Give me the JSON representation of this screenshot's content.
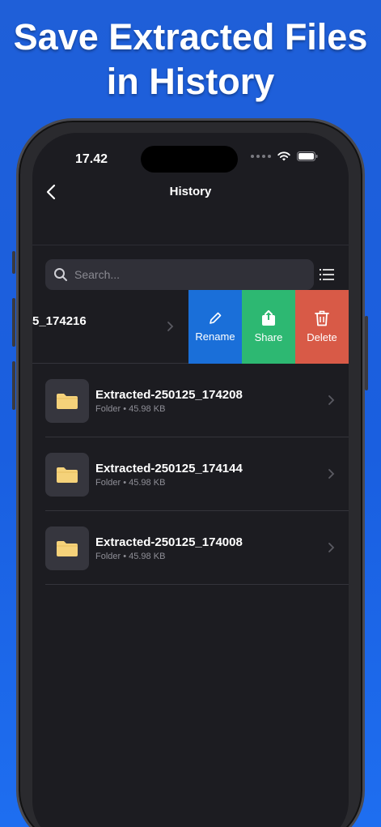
{
  "headline": {
    "line1": "Save Extracted Files",
    "line2": "in History"
  },
  "status_bar": {
    "time": "17.42"
  },
  "nav": {
    "title": "History"
  },
  "search": {
    "placeholder": "Search..."
  },
  "swiped_row": {
    "name": "5_174216",
    "actions": [
      {
        "label": "Rename",
        "color": "#1a6fd9",
        "icon": "pencil-icon"
      },
      {
        "label": "Share",
        "color": "#2db872",
        "icon": "share-icon"
      },
      {
        "label": "Delete",
        "color": "#d85a47",
        "icon": "trash-icon"
      }
    ]
  },
  "files": [
    {
      "name": "Extracted-250125_174208",
      "meta": "Folder • 45.98 KB"
    },
    {
      "name": "Extracted-250125_174144",
      "meta": "Folder • 45.98 KB"
    },
    {
      "name": "Extracted-250125_174008",
      "meta": "Folder • 45.98 KB"
    }
  ],
  "colors": {
    "background": "#1f5fd8",
    "screen": "#1c1c21",
    "folder": "#f5d27a"
  }
}
